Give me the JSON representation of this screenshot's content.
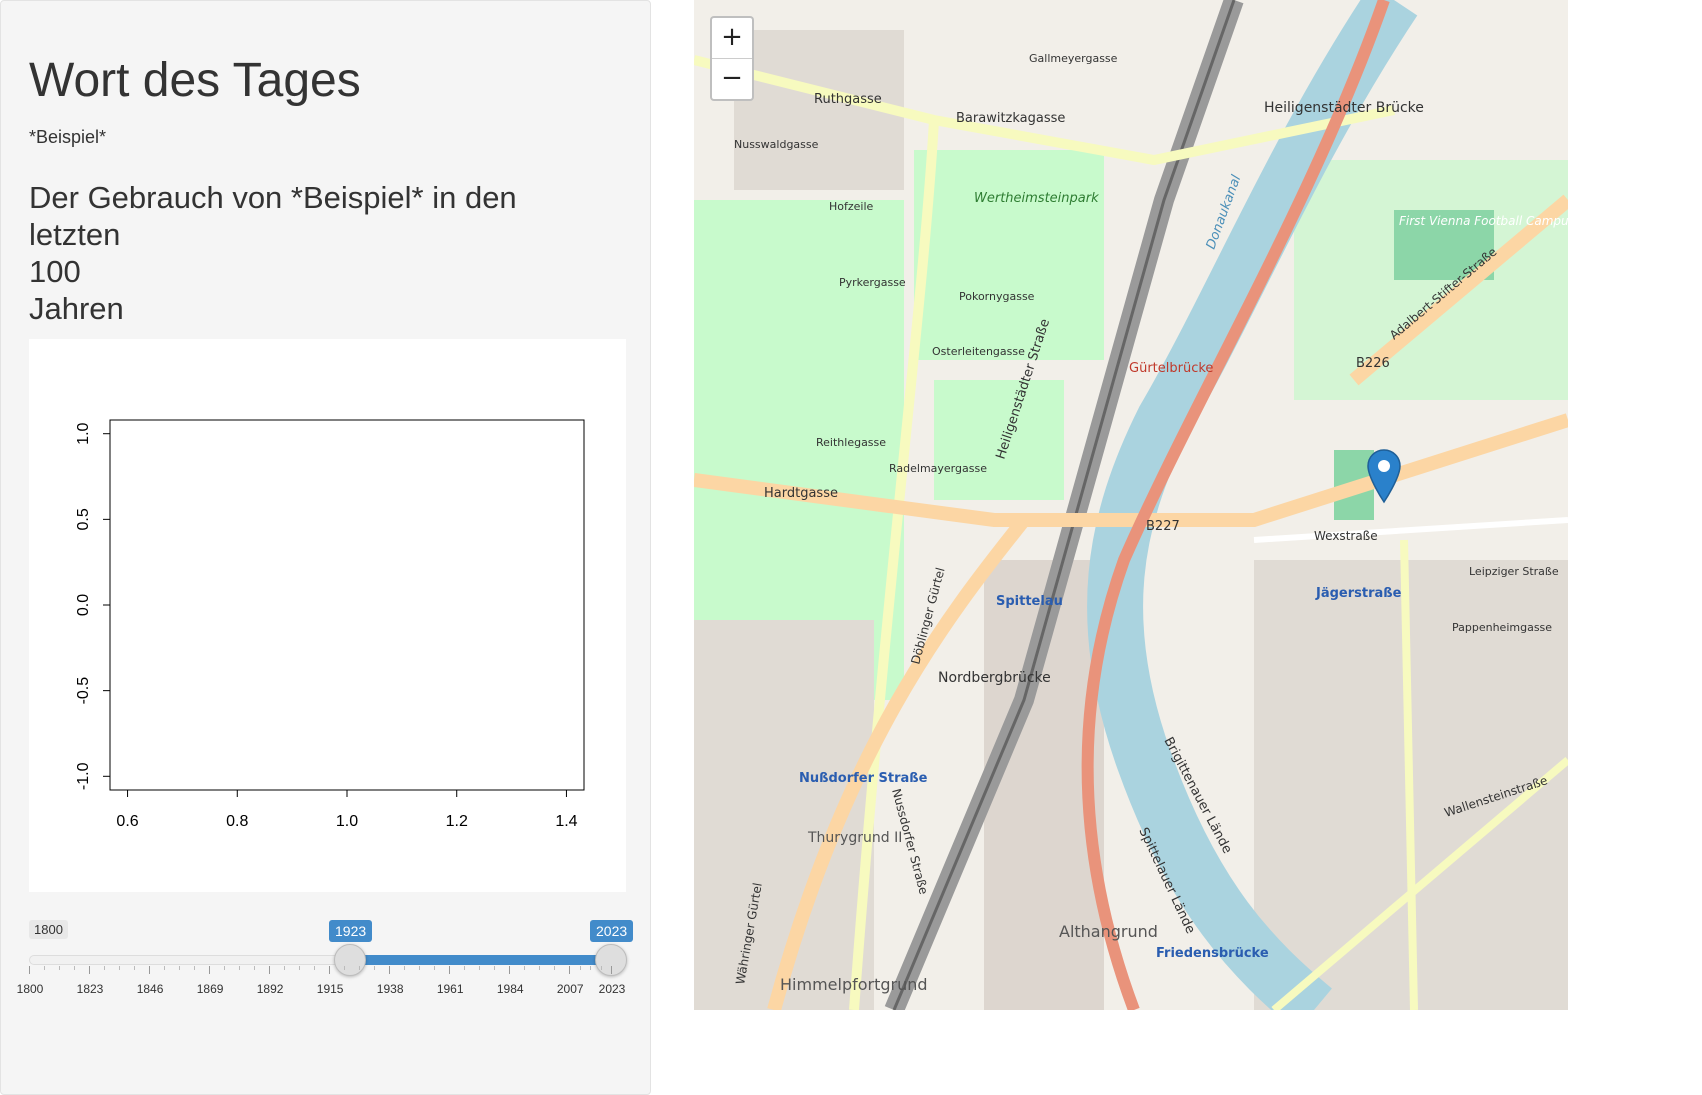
{
  "panel": {
    "title": "Wort des Tages",
    "word": "*Beispiel*",
    "subheading_lines": [
      "Der Gebrauch von *Beispiel* in den",
      "letzten",
      "100",
      "Jahren"
    ]
  },
  "chart_data": {
    "type": "line",
    "title": "",
    "xlabel": "",
    "ylabel": "",
    "series": [],
    "xlim": [
      0.6,
      1.4
    ],
    "ylim": [
      -1.0,
      1.0
    ],
    "x_tick_labels": [
      "0.6",
      "0.8",
      "1.0",
      "1.2",
      "1.4"
    ],
    "y_tick_labels": [
      "-1.0",
      "-0.5",
      "0.0",
      "0.5",
      "1.0"
    ],
    "grid": false
  },
  "slider": {
    "min_label": "1800",
    "max_label": "2023",
    "from_value": "1923",
    "to_value": "2023",
    "from": 1923,
    "to": 2023,
    "min": 1800,
    "max": 2023,
    "tick_labels": [
      "1800",
      "1823",
      "1846",
      "1869",
      "1892",
      "1915",
      "1938",
      "1961",
      "1984",
      "2007",
      "2023"
    ],
    "accent_color": "#428bca"
  },
  "map": {
    "zoom_in": "+",
    "zoom_out": "−",
    "marker_icon": "map-marker-icon",
    "marker_color": "#2a81cb",
    "labels": [
      "Ruthgasse",
      "Barawitzkagasse",
      "Gallmeyergasse",
      "Heiligenstädter Brücke",
      "Nusswaldgasse",
      "Hofzeile",
      "Wertheimsteinpark",
      "First Vienna Football Campus",
      "Pyrkergasse",
      "Pokornygasse",
      "Osterleitengasse",
      "Gürtelbrücke",
      "B226",
      "Adalbert-Stifter-Straße",
      "Reithlegasse",
      "Radelmayergasse",
      "Hardtgasse",
      "B227",
      "Wexstraße",
      "Spittelau",
      "Jägerstraße",
      "Leipziger Straße",
      "Pappenheimgasse",
      "Nordbergbrücke",
      "Nußdorfer Straße",
      "Thurygrund II",
      "Althangrund",
      "Friedensbrücke",
      "Himmelpfortgrund",
      "Wallensteinstraße",
      "Brigittenauer Lände",
      "Donaukanal",
      "Heiligenstädter Straße",
      "Döblinger Gürtel",
      "Währinger Gürtel",
      "Nussdorfer Straße",
      "Spittelauer Lände"
    ]
  }
}
